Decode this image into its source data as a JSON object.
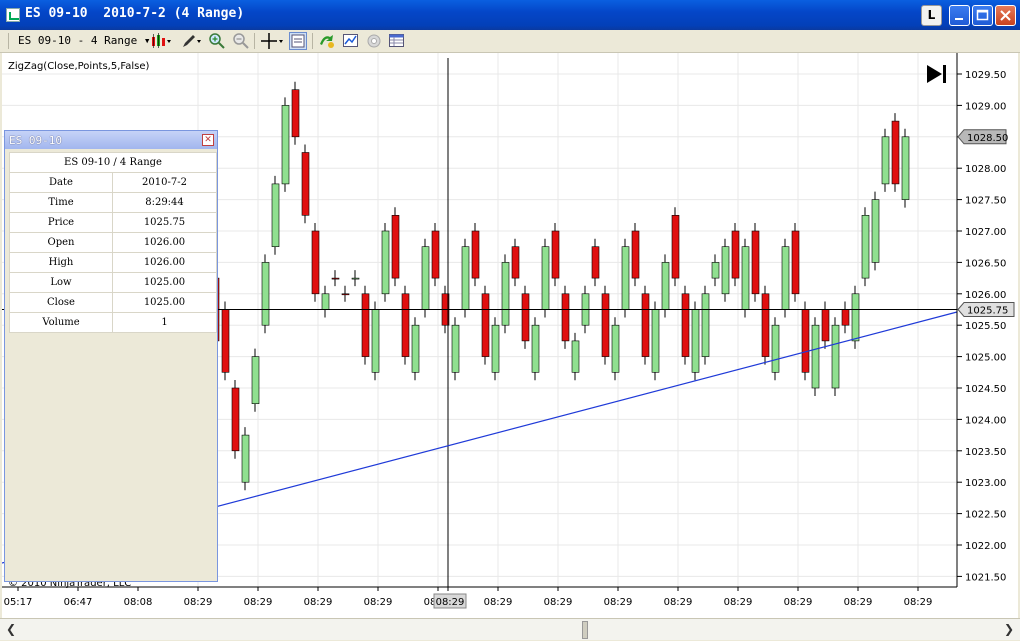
{
  "window": {
    "title": "ES 09-10  2010-7-2 (4 Range)",
    "btn_l": "L"
  },
  "toolbar": {
    "instrument": "ES 09-10 - 4 Range",
    "dropdown_arrow": "▾"
  },
  "chart": {
    "indicator_label": "ZigZag(Close,Points,5,False)",
    "copyright": "© 2010 NinjaTrader, LLC",
    "price_ticks": [
      "1029.50",
      "1029.00",
      "1028.50",
      "1028.00",
      "1027.50",
      "1027.00",
      "1026.50",
      "1026.00",
      "1025.50",
      "1025.00",
      "1024.50",
      "1024.00",
      "1023.50",
      "1023.00",
      "1022.50",
      "1022.00",
      "1021.50"
    ],
    "time_labels": [
      "05:17",
      "06:47",
      "08:08",
      "08:29",
      "08:29",
      "08:29",
      "08:29",
      "08:29",
      "08:29",
      "08:29",
      "08:29",
      "08:29",
      "08:29",
      "08:29",
      "08:29",
      "08:29"
    ],
    "last_price_label": "1028.50",
    "crosshair_price_label": "1025.75",
    "crosshair_time_label": "08:29",
    "colors": {
      "up": "#90e090",
      "down": "#e01010",
      "zigzag": "#1f3ad8",
      "grid": "#e8e8e8"
    }
  },
  "data_window": {
    "title": "ES 09-10",
    "header": "ES 09-10 / 4 Range",
    "rows": [
      {
        "label": "Date",
        "value": "2010-7-2"
      },
      {
        "label": "Time",
        "value": "8:29:44"
      },
      {
        "label": "Price",
        "value": "1025.75"
      },
      {
        "label": "Open",
        "value": "1026.00"
      },
      {
        "label": "High",
        "value": "1026.00"
      },
      {
        "label": "Low",
        "value": "1025.00"
      },
      {
        "label": "Close",
        "value": "1025.00"
      },
      {
        "label": "Volume",
        "value": "1"
      }
    ]
  }
}
